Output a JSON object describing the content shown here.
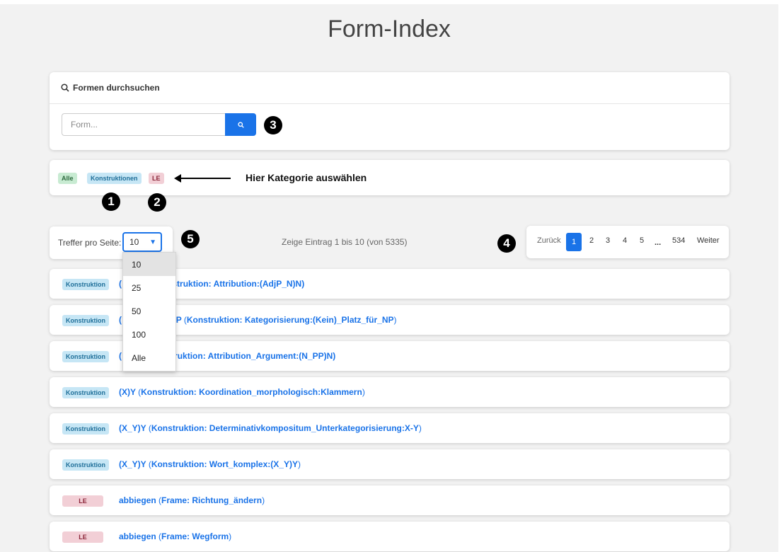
{
  "page": {
    "title": "Form-Index"
  },
  "search": {
    "header": "Formen durchsuchen",
    "placeholder": "Form...",
    "value": ""
  },
  "categories": {
    "items": [
      "Alle",
      "Konstruktionen",
      "LE"
    ],
    "annotation": "Hier Kategorie auswählen"
  },
  "markers": [
    "1",
    "2",
    "3",
    "4",
    "5"
  ],
  "per_page": {
    "label": "Treffer pro Seite:",
    "selected": "10",
    "options": [
      "10",
      "25",
      "50",
      "100",
      "Alle"
    ]
  },
  "info": "Zeige Eintrag 1 bis 10 (von 5335)",
  "pagination": {
    "prev": "Zurück",
    "pages": [
      "1",
      "2",
      "3",
      "4",
      "5"
    ],
    "ellipsis": "...",
    "last": "534",
    "next": "Weiter",
    "active": "1"
  },
  "results": [
    {
      "tag": "Konstruktion",
      "tag_type": "kon",
      "form": "(",
      "detail": "Konstruktion: Attribution:(AdjP_N)N",
      "visible_detail": "onstruktion: Attribution:(AdjP_N)N)"
    },
    {
      "tag": "Konstruktion",
      "tag_type": "kon",
      "form": "(",
      "visible_form_tail": "r_NP",
      "detail": "Konstruktion: Kategorisierung:(Kein)_Platz_für_NP"
    },
    {
      "tag": "Konstruktion",
      "tag_type": "kon",
      "form": "(",
      "visible_detail": "struktion: Attribution_Argument:(N_PP)N)"
    },
    {
      "tag": "Konstruktion",
      "tag_type": "kon",
      "form": "(X)Y",
      "detail": "Konstruktion: Koordination_morphologisch:Klammern"
    },
    {
      "tag": "Konstruktion",
      "tag_type": "kon",
      "form": "(X_Y)Y",
      "detail": "Konstruktion: Determinativkompositum_Unterkategorisierung:X-Y"
    },
    {
      "tag": "Konstruktion",
      "tag_type": "kon",
      "form": "(X_Y)Y",
      "detail": "Konstruktion: Wort_komplex:(X_Y)Y"
    },
    {
      "tag": "LE",
      "tag_type": "le",
      "form": "abbiegen",
      "detail": "Frame: Richtung_ändern"
    },
    {
      "tag": "LE",
      "tag_type": "le",
      "form": "abbiegen",
      "detail": "Frame: Wegform"
    }
  ],
  "colors": {
    "accent": "#1a73e8",
    "tag_green": "#c8ebd2",
    "tag_blue": "#c6e6f5",
    "tag_red": "#f2cfd6",
    "background": "#f2f2f2"
  }
}
